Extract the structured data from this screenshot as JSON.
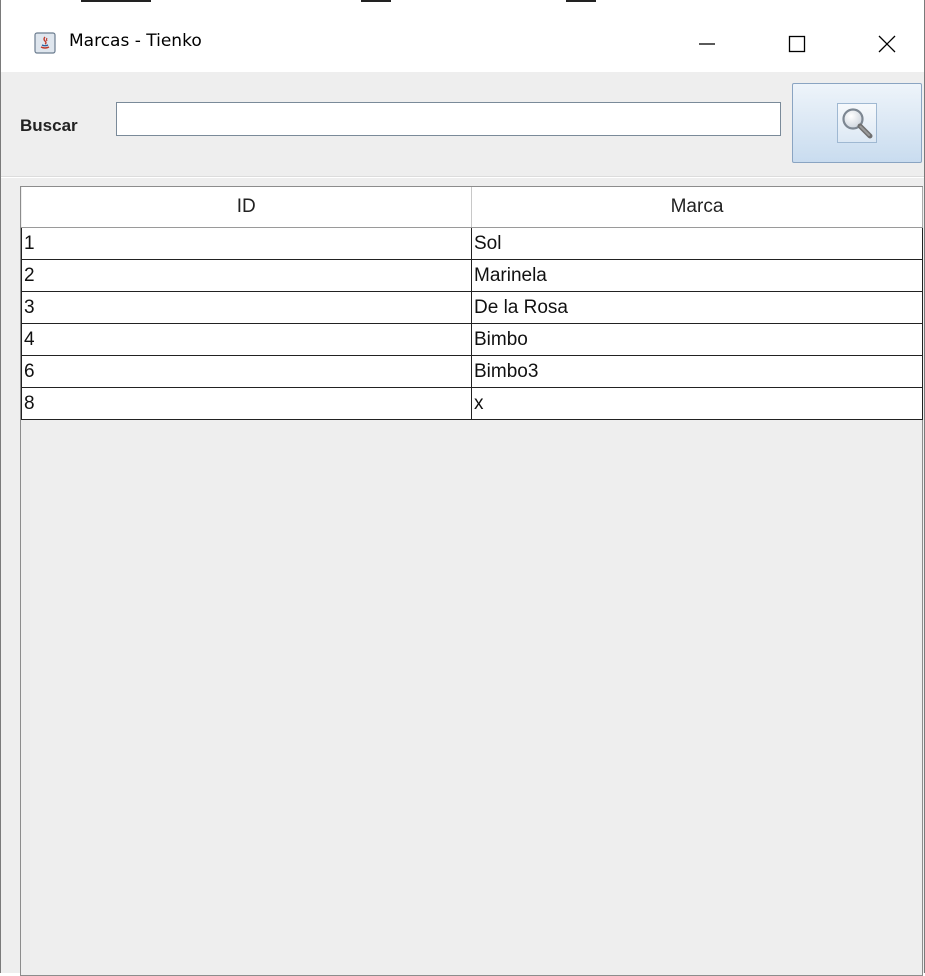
{
  "window": {
    "title": "Marcas - Tienko"
  },
  "search": {
    "label": "Buscar",
    "value": "",
    "placeholder": "",
    "button_icon": "magnifier-icon"
  },
  "table": {
    "columns": [
      "ID",
      "Marca"
    ],
    "rows": [
      {
        "id": "1",
        "marca": "Sol"
      },
      {
        "id": "2",
        "marca": "Marinela"
      },
      {
        "id": "3",
        "marca": "De la Rosa"
      },
      {
        "id": "4",
        "marca": "Bimbo"
      },
      {
        "id": "6",
        "marca": "Bimbo3"
      },
      {
        "id": "8",
        "marca": "x"
      }
    ]
  },
  "colors": {
    "panel_background": "#eeeeee",
    "button_gradient_top": "#eef4fa",
    "button_gradient_bottom": "#c9dcef"
  }
}
